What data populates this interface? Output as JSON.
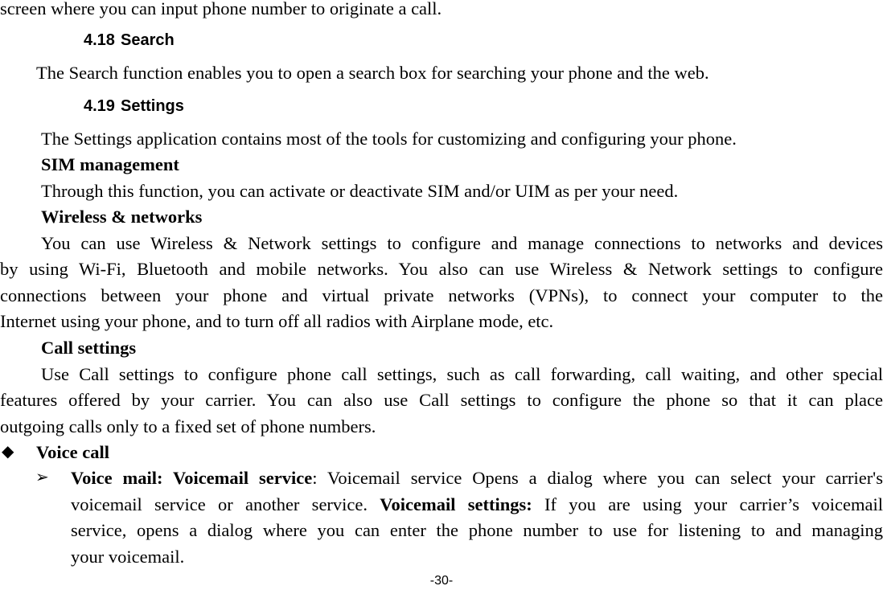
{
  "page": {
    "continued_line": "screen where you can input phone number to originate a call.",
    "sections": [
      {
        "number": "4.18",
        "title": "Search",
        "body": "The Search function enables you to open a search box for searching your phone and the web."
      },
      {
        "number": "4.19",
        "title": "Settings",
        "body": "The Settings application contains most of the tools for customizing and configuring your phone."
      }
    ],
    "sim": {
      "title": "SIM management",
      "body": "Through this function, you can activate or deactivate SIM and/or UIM as per your need."
    },
    "wireless": {
      "title": "Wireless & networks",
      "lines": [
        "You can use Wireless & Network settings to configure and manage connections to networks and devices",
        "by using Wi-Fi, Bluetooth and mobile networks. You also can use Wireless & Network settings to configure",
        "connections between your phone and virtual private networks (VPNs), to connect your computer to the",
        "Internet using your phone, and to turn off all radios with Airplane mode, etc."
      ]
    },
    "call": {
      "title": "Call settings",
      "lines": [
        "Use Call settings to configure phone call settings, such as call forwarding, call waiting, and other special",
        "features offered by your carrier. You can also use Call settings to configure the phone so that it can place",
        "outgoing calls only to a fixed set of phone numbers."
      ]
    },
    "voice_call": {
      "bullet_icon": "diamond-bullet-icon",
      "title": "Voice call",
      "item": {
        "arrow_icon": "arrowhead-bullet-icon",
        "term1": "Voice mail: Voicemail service",
        "line1_rest": ": Voicemail service Opens a dialog where you can select your carrier's",
        "line2_pre": "voicemail service or another service.",
        "term2": "Voicemail settings:",
        "line2_post": "If you are using your carrier’s voicemail",
        "line3": "service, opens a dialog where you can enter the phone number to use for listening to and managing",
        "line4": "your voicemail."
      }
    },
    "page_number": "-30-"
  }
}
